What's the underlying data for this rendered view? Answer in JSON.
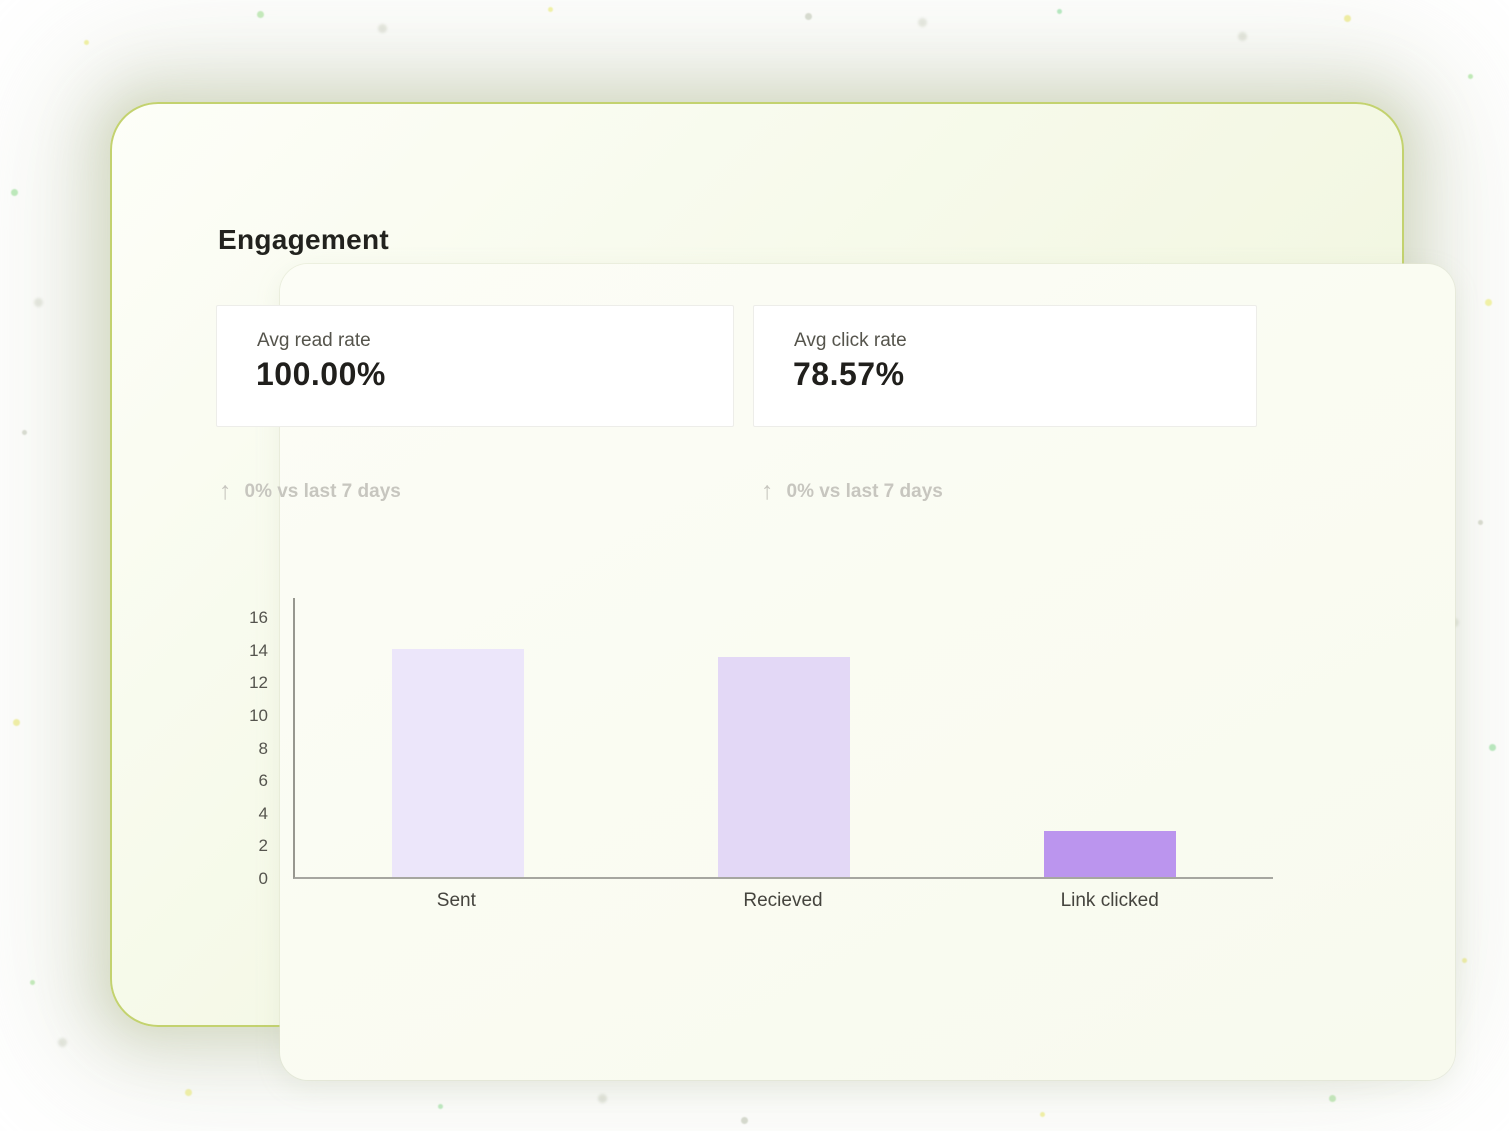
{
  "panel": {
    "title": "Engagement"
  },
  "icons": {
    "up_arrow": "↑"
  },
  "stat_cards": [
    {
      "label": "Avg read rate",
      "value": "100.00%",
      "delta": "0% vs last 7 days",
      "delta_icon": "up-arrow-icon"
    },
    {
      "label": "Avg click rate",
      "value": "78.57%",
      "delta": "0% vs last 7 days",
      "delta_icon": "up-arrow-icon"
    }
  ],
  "chart_data": {
    "type": "bar",
    "title": "",
    "xlabel": "",
    "ylabel": "",
    "categories": [
      "Sent",
      "Recieved",
      "Link clicked"
    ],
    "values": [
      14,
      13.5,
      2.8
    ],
    "bar_colors": [
      "#ECE6FA",
      "#E3D8F6",
      "#BB95EE"
    ],
    "ylim": [
      0,
      16
    ],
    "yticks": [
      0,
      2,
      4,
      6,
      8,
      10,
      12,
      14,
      16
    ],
    "grid": false,
    "legend": false
  },
  "colors": {
    "panel_border": "#C3D26F",
    "panel_bg_start": "#FDFEF8",
    "panel_bg_end": "#ECF2D8",
    "stat_card_border": "#EDEDE9",
    "title_text": "#22221E",
    "stat_label_text": "#55544C",
    "stat_value_text": "#201F1C",
    "delta_text": "#C7C6BF",
    "axis_line": "#97978F",
    "tick_text": "#55544E",
    "category_text": "#45443E",
    "bar_sent": "#ECE6FA",
    "bar_received": "#E3D8F6",
    "bar_link_clicked": "#BB95EE"
  }
}
